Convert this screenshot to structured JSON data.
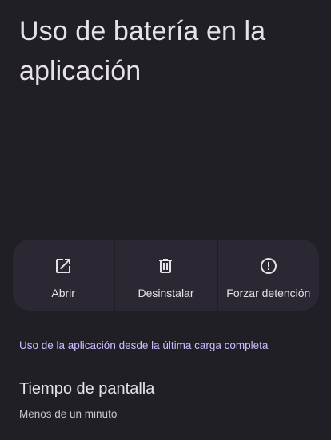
{
  "header": {
    "title": "Uso de batería en la aplicación"
  },
  "actions": [
    {
      "label": "Abrir",
      "icon": "open-in-new-icon"
    },
    {
      "label": "Desinstalar",
      "icon": "trash-icon"
    },
    {
      "label": "Forzar detención",
      "icon": "alert-circle-icon"
    }
  ],
  "usage": {
    "section_link": "Uso de la aplicación desde la última carga completa",
    "screen_time": {
      "title": "Tiempo de pantalla",
      "value": "Menos de un minuto"
    }
  },
  "colors": {
    "background": "#211f26",
    "card": "#2b2833",
    "accent": "#cfbcff",
    "text": "#e6e1e5"
  }
}
